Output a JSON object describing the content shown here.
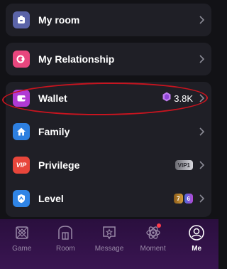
{
  "colors": {
    "background": "#121216",
    "card": "#1f1f26",
    "annotation": "#c8141f",
    "tabbar": "#2f1246",
    "tab_inactive": "#9a8aa8",
    "tab_active": "#ffffff"
  },
  "menu": {
    "items": [
      {
        "id": "my-room",
        "label": "My room",
        "icon": "home-door-icon",
        "icon_color": "#5b64a8"
      },
      {
        "id": "my-relationship",
        "label": "My Relationship",
        "icon": "relationship-icon",
        "icon_color": "#e8467e"
      },
      {
        "id": "wallet",
        "label": "Wallet",
        "icon": "wallet-icon",
        "icon_color": "#b03ad4",
        "balance": "3.8K",
        "balance_icon": "gem-icon"
      },
      {
        "id": "family",
        "label": "Family",
        "icon": "house-icon",
        "icon_color": "#2d7fe0"
      },
      {
        "id": "privilege",
        "label": "Privilege",
        "icon": "vip-icon",
        "icon_text": "VIP",
        "icon_color": "#e8463b",
        "badge": "VIP1"
      },
      {
        "id": "level",
        "label": "Level",
        "icon": "level-icon",
        "icon_color": "#2f84e6",
        "badges": [
          "7",
          "6"
        ]
      }
    ]
  },
  "tabbar": {
    "tabs": [
      {
        "id": "game",
        "label": "Game",
        "icon": "game-icon",
        "active": false
      },
      {
        "id": "room",
        "label": "Room",
        "icon": "room-icon",
        "active": false
      },
      {
        "id": "message",
        "label": "Message",
        "icon": "message-icon",
        "active": false
      },
      {
        "id": "moment",
        "label": "Moment",
        "icon": "moment-icon",
        "active": false,
        "notification": true
      },
      {
        "id": "me",
        "label": "Me",
        "icon": "me-icon",
        "active": true
      }
    ]
  }
}
